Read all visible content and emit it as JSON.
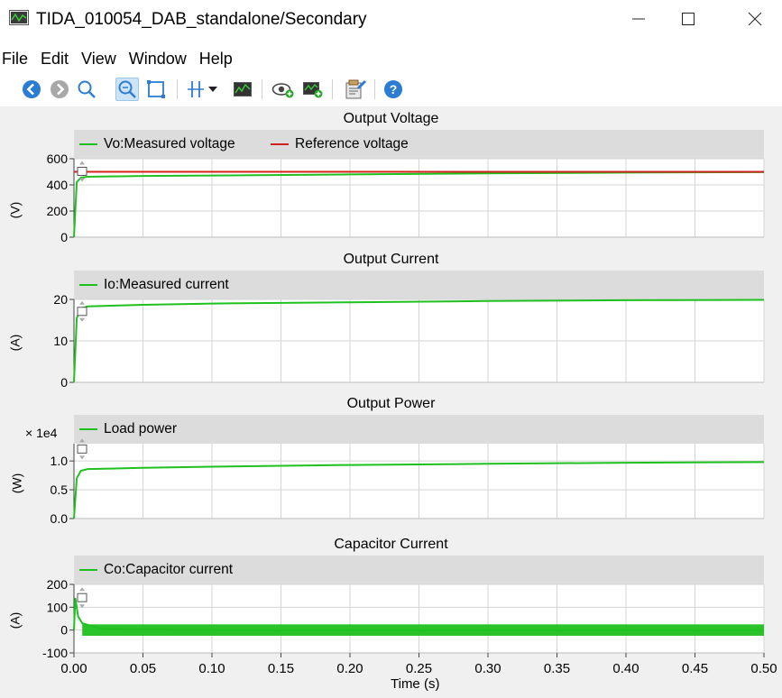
{
  "window": {
    "title": "TIDA_010054_DAB_standalone/Secondary",
    "minimize": "—",
    "maximize": "☐",
    "close": "✕"
  },
  "menu": [
    "File",
    "Edit",
    "View",
    "Window",
    "Help"
  ],
  "toolbar": {
    "icons": [
      "back-icon",
      "forward-icon",
      "zoom-icon",
      "zoom-fit-icon",
      "zoom-box-icon",
      "cursor-icon",
      "dropdown-arrow-icon",
      "spectrum-icon",
      "watch-icon",
      "add-scope-icon",
      "settings-icon",
      "help-icon"
    ],
    "active": "zoom-fit-icon"
  },
  "colors": {
    "green": "#1fc11f",
    "red": "#d62020",
    "legend_bg": "#dcdcdc",
    "plot_bg": "#ffffff",
    "area_bg": "#f0f0f0",
    "grid": "#d4d4d4"
  },
  "panels": [
    {
      "title": "Output Voltage",
      "ylabel": "(V)",
      "scale": "",
      "legend": [
        {
          "label": "Vo:Measured voltage",
          "color": "#1fc11f"
        },
        {
          "label": "Reference voltage",
          "color": "#d62020"
        }
      ]
    },
    {
      "title": "Output Current",
      "ylabel": "(A)",
      "scale": "",
      "legend": [
        {
          "label": "Io:Measured current",
          "color": "#1fc11f"
        }
      ]
    },
    {
      "title": "Output Power",
      "ylabel": "(W)",
      "scale": "× 1e4",
      "legend": [
        {
          "label": "Load power",
          "color": "#1fc11f"
        }
      ]
    },
    {
      "title": "Capacitor Current",
      "ylabel": "(A)",
      "scale": "",
      "legend": [
        {
          "label": "Co:Capacitor current",
          "color": "#1fc11f"
        }
      ]
    }
  ],
  "xaxis": {
    "label": "Time (s)",
    "ticks": [
      "0.00",
      "0.05",
      "0.10",
      "0.15",
      "0.20",
      "0.25",
      "0.30",
      "0.35",
      "0.40",
      "0.45",
      "0.50"
    ]
  },
  "chart_data": [
    {
      "type": "line",
      "title": "Output Voltage",
      "ylabel": "(V)",
      "xlabel": "Time (s)",
      "xlim": [
        0,
        0.5
      ],
      "ylim": [
        0,
        600
      ],
      "yticks": [
        "600",
        "400",
        "200",
        "0"
      ],
      "series": [
        {
          "name": "Vo:Measured voltage",
          "x": [
            0,
            0.002,
            0.005,
            0.01,
            0.05,
            0.1,
            0.2,
            0.3,
            0.4,
            0.5
          ],
          "y": [
            0,
            420,
            455,
            462,
            468,
            472,
            480,
            488,
            494,
            497
          ]
        },
        {
          "name": "Reference voltage",
          "x": [
            0,
            0.5
          ],
          "y": [
            500,
            500
          ]
        }
      ]
    },
    {
      "type": "line",
      "title": "Output Current",
      "ylabel": "(A)",
      "xlabel": "Time (s)",
      "xlim": [
        0,
        0.5
      ],
      "ylim": [
        0,
        20
      ],
      "yticks": [
        "20",
        "10",
        "0"
      ],
      "series": [
        {
          "name": "Io:Measured current",
          "x": [
            0,
            0.002,
            0.005,
            0.01,
            0.05,
            0.1,
            0.2,
            0.3,
            0.4,
            0.5
          ],
          "y": [
            0,
            15.5,
            17.8,
            18.3,
            18.7,
            19.0,
            19.3,
            19.6,
            19.8,
            19.9
          ]
        }
      ]
    },
    {
      "type": "line",
      "title": "Output Power",
      "ylabel": "(W)",
      "scale": "× 1e4",
      "xlabel": "Time (s)",
      "xlim": [
        0,
        0.5
      ],
      "ylim": [
        0,
        1.3
      ],
      "yticks": [
        "1.0",
        "0.5",
        "0.0"
      ],
      "series": [
        {
          "name": "Load power",
          "x": [
            0,
            0.002,
            0.005,
            0.01,
            0.05,
            0.1,
            0.2,
            0.3,
            0.4,
            0.5
          ],
          "y": [
            0,
            0.7,
            0.83,
            0.86,
            0.88,
            0.9,
            0.93,
            0.95,
            0.97,
            0.98
          ]
        }
      ]
    },
    {
      "type": "line",
      "title": "Capacitor Current",
      "ylabel": "(A)",
      "xlabel": "Time (s)",
      "xlim": [
        0,
        0.5
      ],
      "ylim": [
        -100,
        200
      ],
      "yticks": [
        "200",
        "100",
        "0",
        "-100"
      ],
      "series": [
        {
          "name": "Co:Capacitor current",
          "x": [
            0,
            0.001,
            0.003,
            0.006,
            0.02,
            0.1,
            0.2,
            0.3,
            0.4,
            0.5
          ],
          "y": [
            0,
            140,
            60,
            30,
            5,
            0,
            0,
            0,
            0,
            0
          ],
          "ripple_band": [
            -25,
            25
          ]
        }
      ]
    }
  ]
}
